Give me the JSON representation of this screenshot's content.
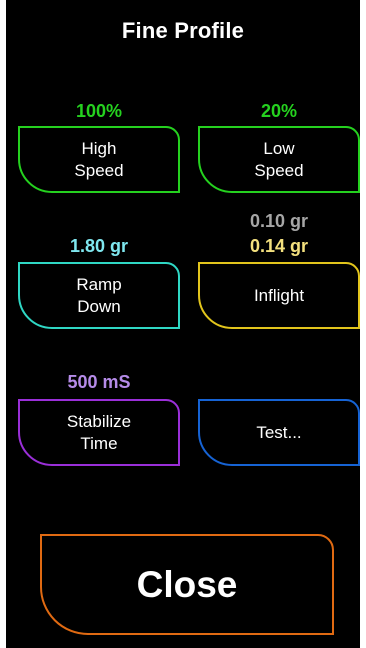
{
  "title": "Fine Profile",
  "high_speed": {
    "value": "100%",
    "label": "High\nSpeed",
    "color": "#25d11f"
  },
  "low_speed": {
    "value": "20%",
    "label": "Low\nSpeed",
    "color": "#25d11f"
  },
  "ramp_down": {
    "value": "1.80 gr",
    "label": "Ramp\nDown",
    "color": "#2fd7c4",
    "value_color": "#7fe7ef"
  },
  "inflight": {
    "value_secondary": "0.10 gr",
    "value": "0.14 gr",
    "label": "Inflight",
    "color": "#e2c51c",
    "value_color": "#f3e07e",
    "secondary_color": "#a6a6a6"
  },
  "stabilize_time": {
    "value": "500 mS",
    "label": "Stabilize\nTime",
    "color": "#9a2fd8",
    "value_color": "#b58be8"
  },
  "test": {
    "label": "Test...",
    "color": "#1663d4"
  },
  "close": {
    "label": "Close",
    "color": "#e06a12"
  }
}
